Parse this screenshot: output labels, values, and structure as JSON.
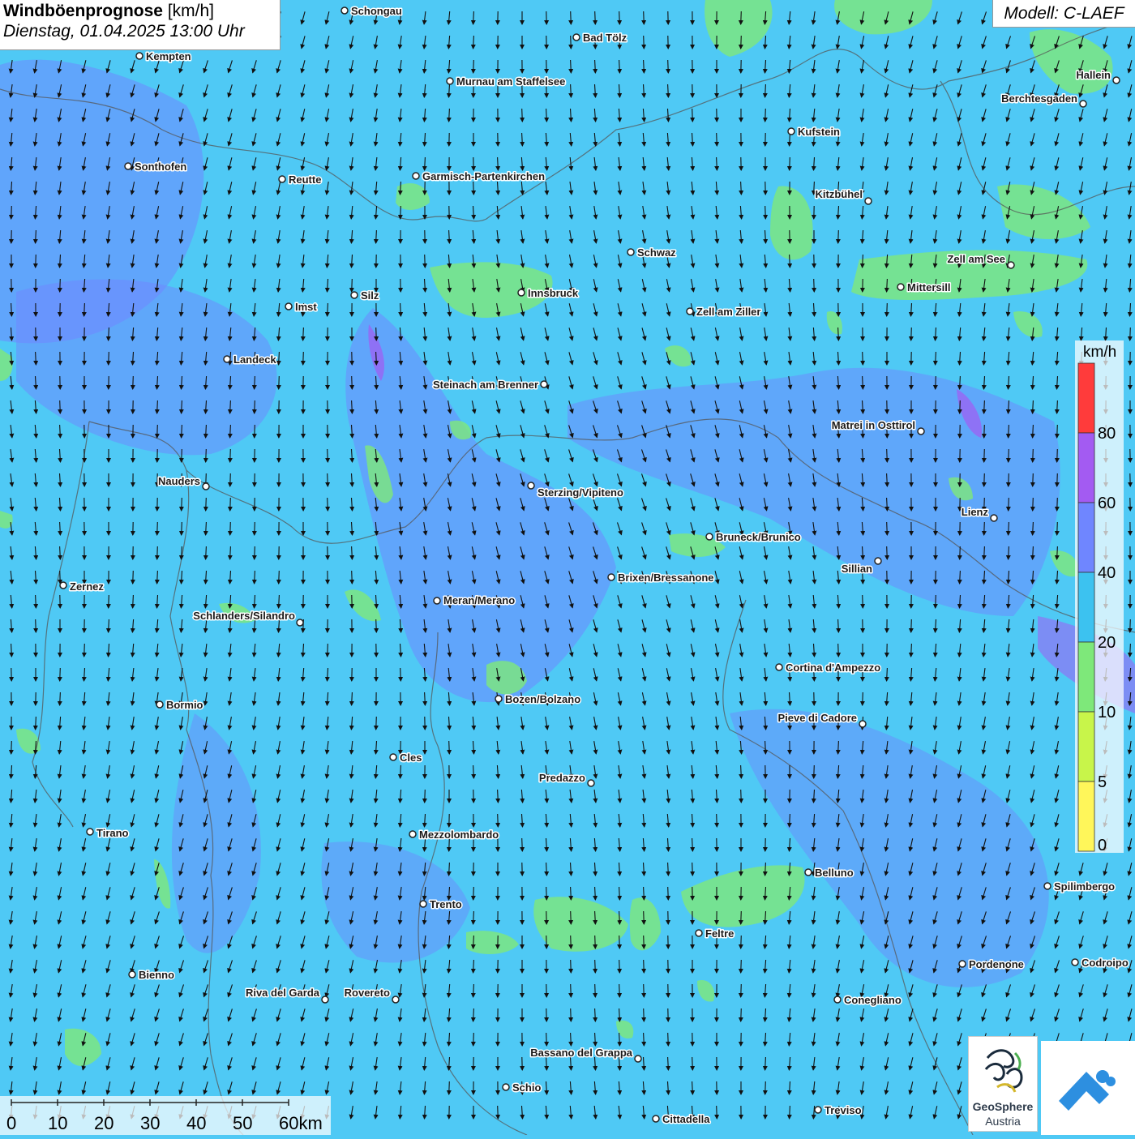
{
  "header": {
    "title_bold": "Windböenprognose",
    "title_unit": "[km/h]",
    "datetime": "Dienstag, 01.04.2025 13:00 Uhr",
    "model": "Modell: C-LAEF"
  },
  "legend": {
    "unit": "km/h",
    "ticks": [
      "80",
      "60",
      "40",
      "20",
      "10",
      "5",
      "0"
    ],
    "colors": [
      "#ff3b3b",
      "#a35bf2",
      "#6f86ff",
      "#3cc2f0",
      "#7ee87a",
      "#c8f54a",
      "#fff65a"
    ]
  },
  "scalebar": {
    "labels": [
      "0",
      "10",
      "20",
      "30",
      "40",
      "50",
      "60km"
    ]
  },
  "logos": {
    "geosphere_line1": "GeoSphere",
    "geosphere_line2": "Austria",
    "app_icon": "wind-app-icon"
  },
  "cities": [
    {
      "name": "Schongau"
    },
    {
      "name": "Bad Tölz"
    },
    {
      "name": "Kempten"
    },
    {
      "name": "Murnau am Staffelsee"
    },
    {
      "name": "Hallein"
    },
    {
      "name": "Berchtesgaden"
    },
    {
      "name": "Kufstein"
    },
    {
      "name": "Sonthofen"
    },
    {
      "name": "Reutte"
    },
    {
      "name": "Garmisch-Partenkirchen"
    },
    {
      "name": "Kitzbühel"
    },
    {
      "name": "Schwaz"
    },
    {
      "name": "Zell am See"
    },
    {
      "name": "Innsbruck"
    },
    {
      "name": "Mittersill"
    },
    {
      "name": "Silz"
    },
    {
      "name": "Imst"
    },
    {
      "name": "Zell am Ziller"
    },
    {
      "name": "Landeck"
    },
    {
      "name": "Steinach am Brenner"
    },
    {
      "name": "Matrei in Osttirol"
    },
    {
      "name": "Nauders"
    },
    {
      "name": "Sterzing/Vipiteno"
    },
    {
      "name": "Lienz"
    },
    {
      "name": "Bruneck/Brunico"
    },
    {
      "name": "Sillian"
    },
    {
      "name": "Zernez"
    },
    {
      "name": "Brixen/Bressanone"
    },
    {
      "name": "Meran/Merano"
    },
    {
      "name": "Schlanders/Silandro"
    },
    {
      "name": "Cortina d'Ampezzo"
    },
    {
      "name": "Bozen/Bolzano"
    },
    {
      "name": "Bormio"
    },
    {
      "name": "Pieve di Cadore"
    },
    {
      "name": "Cles"
    },
    {
      "name": "Predazzo"
    },
    {
      "name": "Tirano"
    },
    {
      "name": "Mezzolombardo"
    },
    {
      "name": "Belluno"
    },
    {
      "name": "Spilimbergo"
    },
    {
      "name": "Trento"
    },
    {
      "name": "Feltre"
    },
    {
      "name": "Pordenone"
    },
    {
      "name": "Codroipo"
    },
    {
      "name": "Bienno"
    },
    {
      "name": "Riva del Garda"
    },
    {
      "name": "Rovereto"
    },
    {
      "name": "Conegliano"
    },
    {
      "name": "Bassano del Grappa"
    },
    {
      "name": "Schio"
    },
    {
      "name": "Treviso"
    },
    {
      "name": "Cittadella"
    }
  ]
}
